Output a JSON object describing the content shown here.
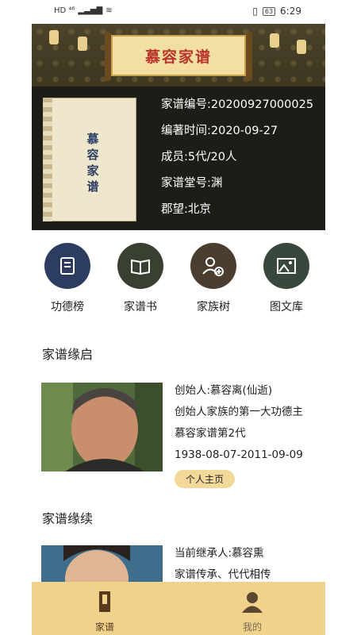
{
  "status_bar": {
    "left_indicators": "HD ⁴⁶",
    "battery": "63",
    "time": "6:29"
  },
  "banner": {
    "title": "慕容家谱"
  },
  "book": {
    "title_chars": [
      "慕",
      "容",
      "家",
      "谱"
    ]
  },
  "info": {
    "lines": [
      "家谱编号:20200927000025",
      "编著时间:2020-09-27",
      "成员:5代/20人",
      "家谱堂号:渊",
      "郡望:北京"
    ]
  },
  "actions": [
    {
      "label": "功德榜",
      "icon": "merit-list-icon",
      "color": "#2d3d62"
    },
    {
      "label": "家谱书",
      "icon": "book-icon",
      "color": "#394031"
    },
    {
      "label": "家族树",
      "icon": "family-tree-icon",
      "color": "#4b3d2f"
    },
    {
      "label": "图文库",
      "icon": "gallery-icon",
      "color": "#39483d"
    }
  ],
  "section_origin": {
    "title": "家谱缘启",
    "lines": [
      "创始人:慕容离(仙逝)",
      "创始人家族的第一大功德主",
      "慕容家谱第2代",
      "1938-08-07-2011-09-09"
    ],
    "button": "个人主页"
  },
  "section_continue": {
    "title": "家谱缘续",
    "lines": [
      "当前继承人:慕容熏",
      "家谱传承、代代相传"
    ]
  },
  "tabbar": [
    {
      "label": "家谱",
      "icon": "genealogy-tab-icon"
    },
    {
      "label": "我的",
      "icon": "profile-tab-icon"
    }
  ]
}
